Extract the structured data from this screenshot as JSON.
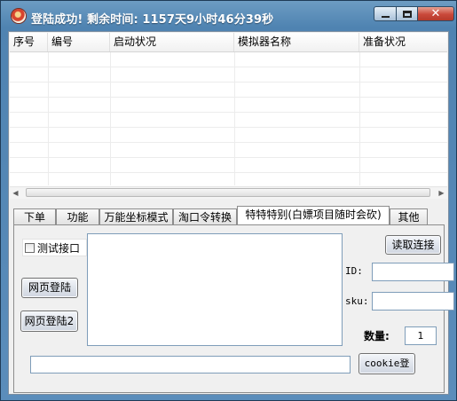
{
  "window": {
    "title": "登陆成功! 剩余时间: 1157天9小时46分39秒",
    "close_glyph": "✕"
  },
  "list": {
    "columns": [
      "序号",
      "编号",
      "启动状况",
      "模拟器名称",
      "准备状况"
    ],
    "rows": []
  },
  "scrollbar": {
    "left_arrow": "◀",
    "right_arrow": "▶"
  },
  "tabs": [
    {
      "label": "下单"
    },
    {
      "label": "功能"
    },
    {
      "label": "万能坐标模式"
    },
    {
      "label": "淘口令转换"
    },
    {
      "label": "特特特别(白嫖项目随时会砍)"
    },
    {
      "label": "其他"
    }
  ],
  "active_tab_index": 4,
  "panel": {
    "test_checkbox_label": "测试接口",
    "test_checkbox_checked": false,
    "web_login_label": "网页登陆",
    "web_login2_label": "网页登陆2",
    "read_connect_label": "读取连接",
    "id_label": "ID:",
    "id_value": "",
    "sku_label": "sku:",
    "sku_value": "",
    "quantity_label": "数量:",
    "quantity_value": "1",
    "cookie_label": "cookie登",
    "cookie_input_value": "",
    "textarea_value": ""
  }
}
